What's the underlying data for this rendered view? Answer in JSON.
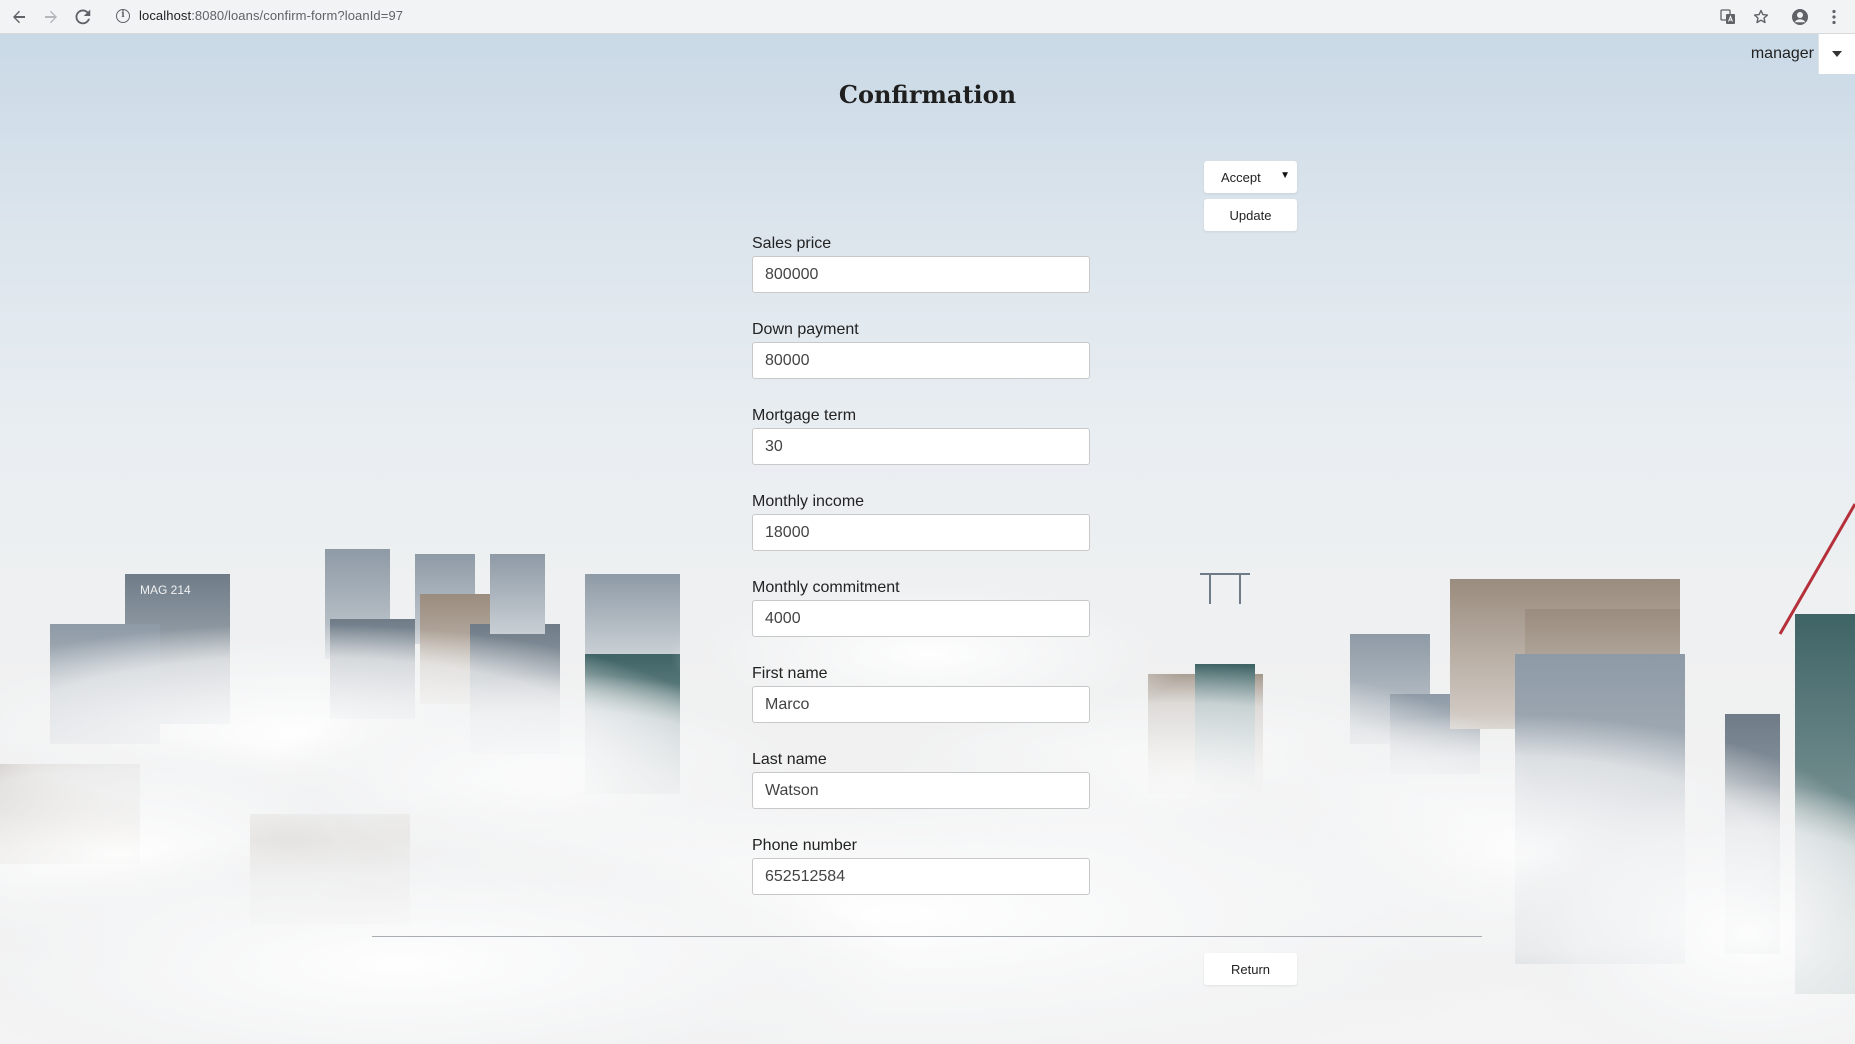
{
  "browser": {
    "url_host": "localhost",
    "url_path": ":8080/loans/confirm-form?loanId=97"
  },
  "header": {
    "user_name": "manager"
  },
  "main": {
    "title": "Confirmation",
    "action_select": {
      "selected": "Accept"
    },
    "update_label": "Update",
    "return_label": "Return",
    "fields": [
      {
        "label": "Sales price",
        "value": "800000"
      },
      {
        "label": "Down payment",
        "value": "80000"
      },
      {
        "label": "Mortgage term",
        "value": "30"
      },
      {
        "label": "Monthly income",
        "value": "18000"
      },
      {
        "label": "Monthly commitment",
        "value": "4000"
      },
      {
        "label": "First name",
        "value": "Marco"
      },
      {
        "label": "Last name",
        "value": "Watson"
      },
      {
        "label": "Phone number",
        "value": "652512584"
      }
    ]
  }
}
